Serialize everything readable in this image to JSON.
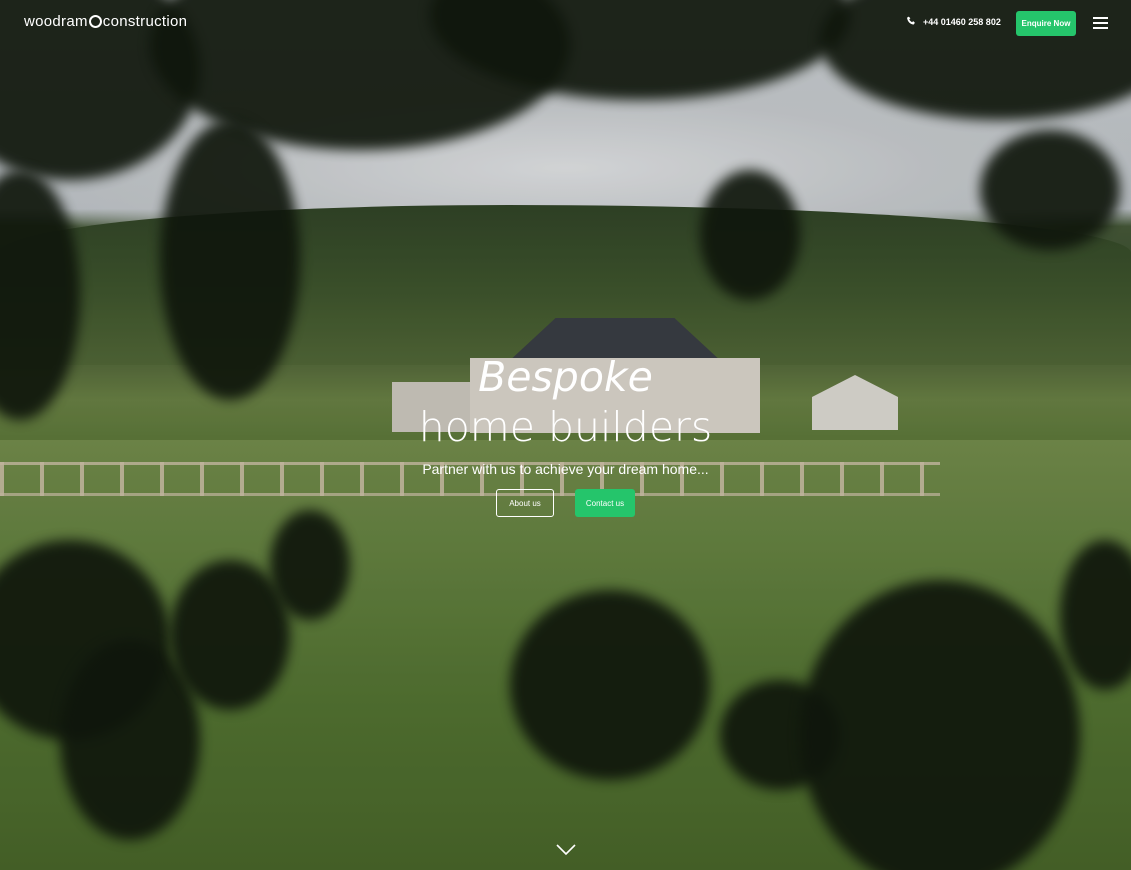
{
  "header": {
    "logo_before": "woodram",
    "logo_after": "construction",
    "phone": "+44 01460 258 802",
    "enquire_label": "Enquire Now"
  },
  "hero": {
    "title_italic": "Bespoke",
    "title_main": "home builders",
    "subtitle": "Partner with us to achieve your dream home...",
    "about_label": "About us",
    "contact_label": "Contact us"
  },
  "colors": {
    "accent": "#25c56b",
    "text": "#ffffff"
  },
  "icons": {
    "phone": "phone-icon",
    "menu": "hamburger-menu-icon",
    "scroll": "chevron-down-icon"
  }
}
